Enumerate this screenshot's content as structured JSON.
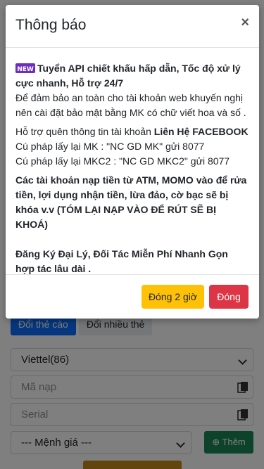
{
  "modal": {
    "title": "Thông báo",
    "close_glyph": "×",
    "badge_text": "NEW",
    "line1": "Tuyển API chiết khấu hấp dẫn,  Tốc độ xử lý cực nhanh, Hỗ trợ 24/7",
    "line2": "Để đảm bảo an toàn cho tài khoản web khuyến nghị nên cài đặt bảo mật bằng MK có chữ viết hoa và số .",
    "support_prefix": "Hỗ trợ quên thông tin tài khoản ",
    "support_link": "Liên Hệ FACEBOOK",
    "syntax_mk": "Cú pháp lấy lại MK : \"NC GD MK\" gửi 8077",
    "syntax_mkc2": "Cú pháp lấy lại MKC2 : \"NC GD MKC2\" gửi 8077",
    "warning": "Các tài khoản nạp tiền từ ATM, MOMO vào để rửa tiền, lợi dụng nhận tiền, lừa đảo, cờ bạc sẽ bị khóa v.v (TÓM LẠI NẠP VÀO ĐỂ RÚT SẼ BỊ KHOÁ)",
    "agent_line": "Đăng Ký Đại Lý, Đối Tác Miễn Phí Nhanh Gọn hợp tác lâu dài .",
    "btn_close_2h": "Đóng 2 giờ",
    "btn_close": "Đóng"
  },
  "background": {
    "tabs": [
      "Đổi thẻ cào",
      "Đổi nhiều thẻ"
    ],
    "carrier_select": "Viettel(86)",
    "code_placeholder": "Mã nạp",
    "serial_placeholder": "Serial",
    "amount_select": "--- Mệnh giá ---",
    "add_button": "Thêm"
  },
  "colors": {
    "primary": "#0d6efd",
    "warning": "#ffc107",
    "danger": "#dc3545",
    "success": "#198754"
  }
}
